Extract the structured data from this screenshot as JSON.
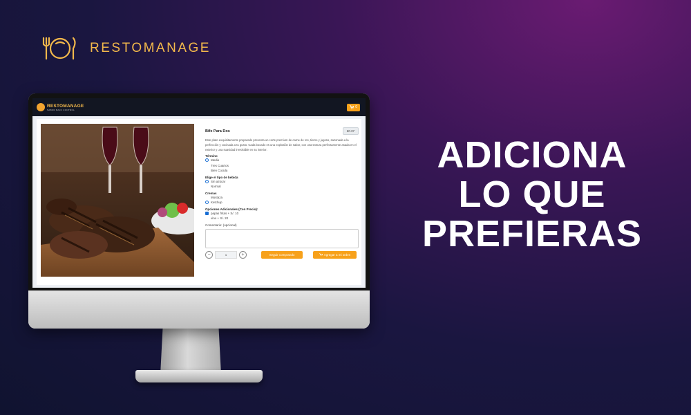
{
  "brand": {
    "name": "RESTOMANAGE",
    "logo_icon": "plate-fork-knife-icon",
    "color": "#f2b84b"
  },
  "headline": [
    "ADICIONA",
    "LO QUE",
    "PREFIERAS"
  ],
  "app": {
    "brand_name": "RESTOMANAGE",
    "brand_tagline": "SABOR BAJO CONTROL",
    "cart": {
      "icon": "cart-icon",
      "count": "0"
    },
    "dish": {
      "name": "Bife Para Dos",
      "price": "60.37",
      "description": "Este plato exquisitamente preparado presenta un corte premium de carne de res, tierno y jugoso, sazonada a la perfección y cocinada a tu gusto. Cada bocado es una explosión de sabor, con una textura perfectamente asada en el exterior y una suavidad irresistible en su interior."
    },
    "groups": [
      {
        "title": "Término",
        "type": "radio",
        "options": [
          {
            "label": "Medio",
            "selected": true
          },
          {
            "label": "Tres Cuartos",
            "selected": false
          },
          {
            "label": "Bien Cocida",
            "selected": false
          }
        ]
      },
      {
        "title": "Elige el tipo de bebida",
        "type": "radio",
        "options": [
          {
            "label": "Sin azúcar",
            "selected": true
          },
          {
            "label": "Normal",
            "selected": false
          }
        ]
      },
      {
        "title": "Cremas",
        "type": "radio",
        "options": [
          {
            "label": "Mostaza",
            "selected": false
          },
          {
            "label": "Ketchup",
            "selected": true
          }
        ]
      },
      {
        "title": "Opciones Adicionales (Con Precio):",
        "type": "checkbox",
        "options": [
          {
            "label": "papas fritas + S/. 10",
            "selected": true
          },
          {
            "label": "vino + S/. 20",
            "selected": false
          }
        ]
      }
    ],
    "comment_label": "Comentario: (opcional)",
    "quantity": "1",
    "continue_label": "Seguir comprando",
    "add_label": "Agregar a mi orden",
    "accent": "#f7a11a"
  }
}
